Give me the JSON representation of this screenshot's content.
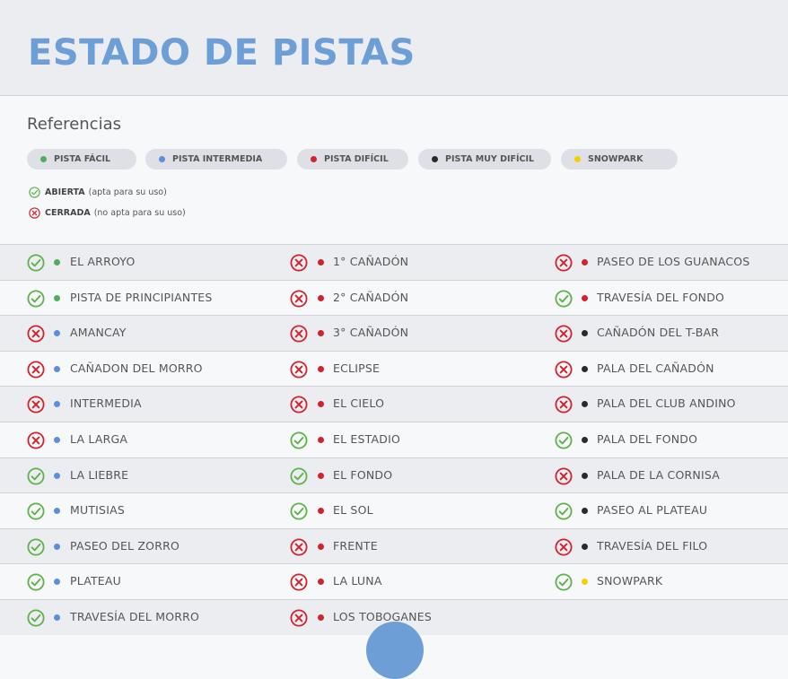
{
  "title": "ESTADO DE PISTAS",
  "references_title": "Referencias",
  "colors": {
    "facil": "#4fae5b",
    "intermedia": "#5b8fdc",
    "dificil": "#d2222d",
    "muy_dificil": "#2a2a2a",
    "snowpark": "#f5d000",
    "open": "#5fb14a",
    "closed": "#d2222d",
    "accent": "#6d9fd6"
  },
  "legend": [
    {
      "label": "PISTA FÁCIL",
      "level": "facil"
    },
    {
      "label": "PISTA INTERMEDIA",
      "level": "intermedia"
    },
    {
      "label": "PISTA DIFÍCIL",
      "level": "dificil"
    },
    {
      "label": "PISTA MUY DIFÍCIL",
      "level": "muy_dificil"
    },
    {
      "label": "SNOWPARK",
      "level": "snowpark"
    }
  ],
  "status_legend": {
    "open": {
      "label": "ABIERTA",
      "note": "(apta para su uso)",
      "icon": "check-circle-icon"
    },
    "closed": {
      "label": "CERRADA",
      "note": "(no apta para su uso)",
      "icon": "x-circle-icon"
    }
  },
  "columns": [
    [
      {
        "name": "EL ARROYO",
        "level": "facil",
        "status": "open"
      },
      {
        "name": "PISTA DE PRINCIPIANTES",
        "level": "facil",
        "status": "open"
      },
      {
        "name": "AMANCAY",
        "level": "intermedia",
        "status": "closed"
      },
      {
        "name": "CAÑADON DEL MORRO",
        "level": "intermedia",
        "status": "closed"
      },
      {
        "name": "INTERMEDIA",
        "level": "intermedia",
        "status": "closed"
      },
      {
        "name": "LA LARGA",
        "level": "intermedia",
        "status": "closed"
      },
      {
        "name": "LA LIEBRE",
        "level": "intermedia",
        "status": "open"
      },
      {
        "name": "MUTISIAS",
        "level": "intermedia",
        "status": "open"
      },
      {
        "name": "PASEO DEL ZORRO",
        "level": "intermedia",
        "status": "open"
      },
      {
        "name": "PLATEAU",
        "level": "intermedia",
        "status": "open"
      },
      {
        "name": "TRAVESÍA DEL MORRO",
        "level": "intermedia",
        "status": "open"
      }
    ],
    [
      {
        "name": "1° CAÑADÓN",
        "level": "dificil",
        "status": "closed"
      },
      {
        "name": "2° CAÑADÓN",
        "level": "dificil",
        "status": "closed"
      },
      {
        "name": "3° CAÑADÓN",
        "level": "dificil",
        "status": "closed"
      },
      {
        "name": "ECLIPSE",
        "level": "dificil",
        "status": "closed"
      },
      {
        "name": "EL CIELO",
        "level": "dificil",
        "status": "closed"
      },
      {
        "name": "EL ESTADIO",
        "level": "dificil",
        "status": "open"
      },
      {
        "name": "EL FONDO",
        "level": "dificil",
        "status": "open"
      },
      {
        "name": "EL SOL",
        "level": "dificil",
        "status": "open"
      },
      {
        "name": "FRENTE",
        "level": "dificil",
        "status": "closed"
      },
      {
        "name": "LA LUNA",
        "level": "dificil",
        "status": "closed"
      },
      {
        "name": "LOS TOBOGANES",
        "level": "dificil",
        "status": "closed"
      }
    ],
    [
      {
        "name": "PASEO DE LOS GUANACOS",
        "level": "dificil",
        "status": "closed"
      },
      {
        "name": "TRAVESÍA DEL FONDO",
        "level": "dificil",
        "status": "open"
      },
      {
        "name": "CAÑADÓN DEL T-BAR",
        "level": "muy_dificil",
        "status": "closed"
      },
      {
        "name": "PALA DEL CAÑADÓN",
        "level": "muy_dificil",
        "status": "closed"
      },
      {
        "name": "PALA DEL CLUB ANDINO",
        "level": "muy_dificil",
        "status": "closed"
      },
      {
        "name": "PALA DEL FONDO",
        "level": "muy_dificil",
        "status": "open"
      },
      {
        "name": "PALA DE LA CORNISA",
        "level": "muy_dificil",
        "status": "closed"
      },
      {
        "name": "PASEO AL PLATEAU",
        "level": "muy_dificil",
        "status": "open"
      },
      {
        "name": "TRAVESÍA DEL FILO",
        "level": "muy_dificil",
        "status": "closed"
      },
      {
        "name": "SNOWPARK",
        "level": "snowpark",
        "status": "open"
      }
    ]
  ]
}
